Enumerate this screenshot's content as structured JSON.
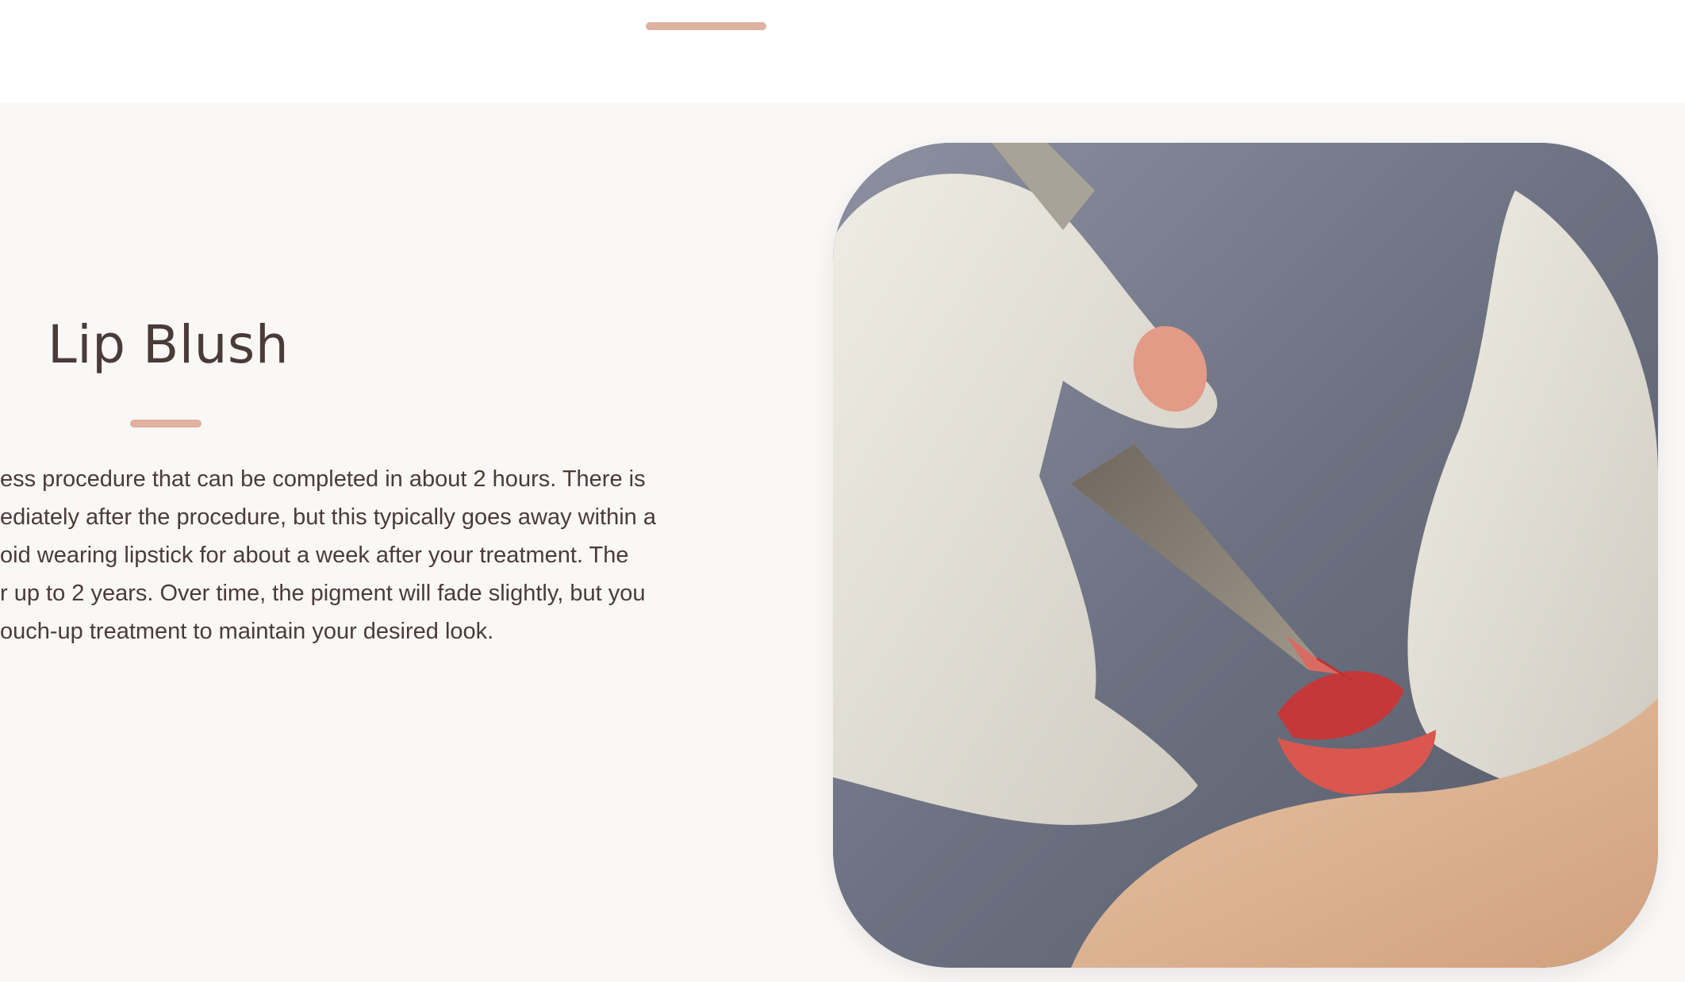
{
  "section": {
    "title": "Lip Blush",
    "body_lines": [
      "ess procedure that can be completed in about 2 hours. There is",
      "ediately after the procedure, but this typically goes away within a",
      "oid wearing lipstick for about a week after your treatment. The",
      "r up to 2 years. Over time, the pigment will fade slightly, but you",
      "ouch-up treatment to maintain your desired look."
    ]
  },
  "image": {
    "subject": "gloved hands holding a tattoo pen applying red pigment to lips"
  },
  "colors": {
    "accent": "#deb1a1",
    "text": "#4a3b38",
    "section_bg": "#faf8f7"
  }
}
